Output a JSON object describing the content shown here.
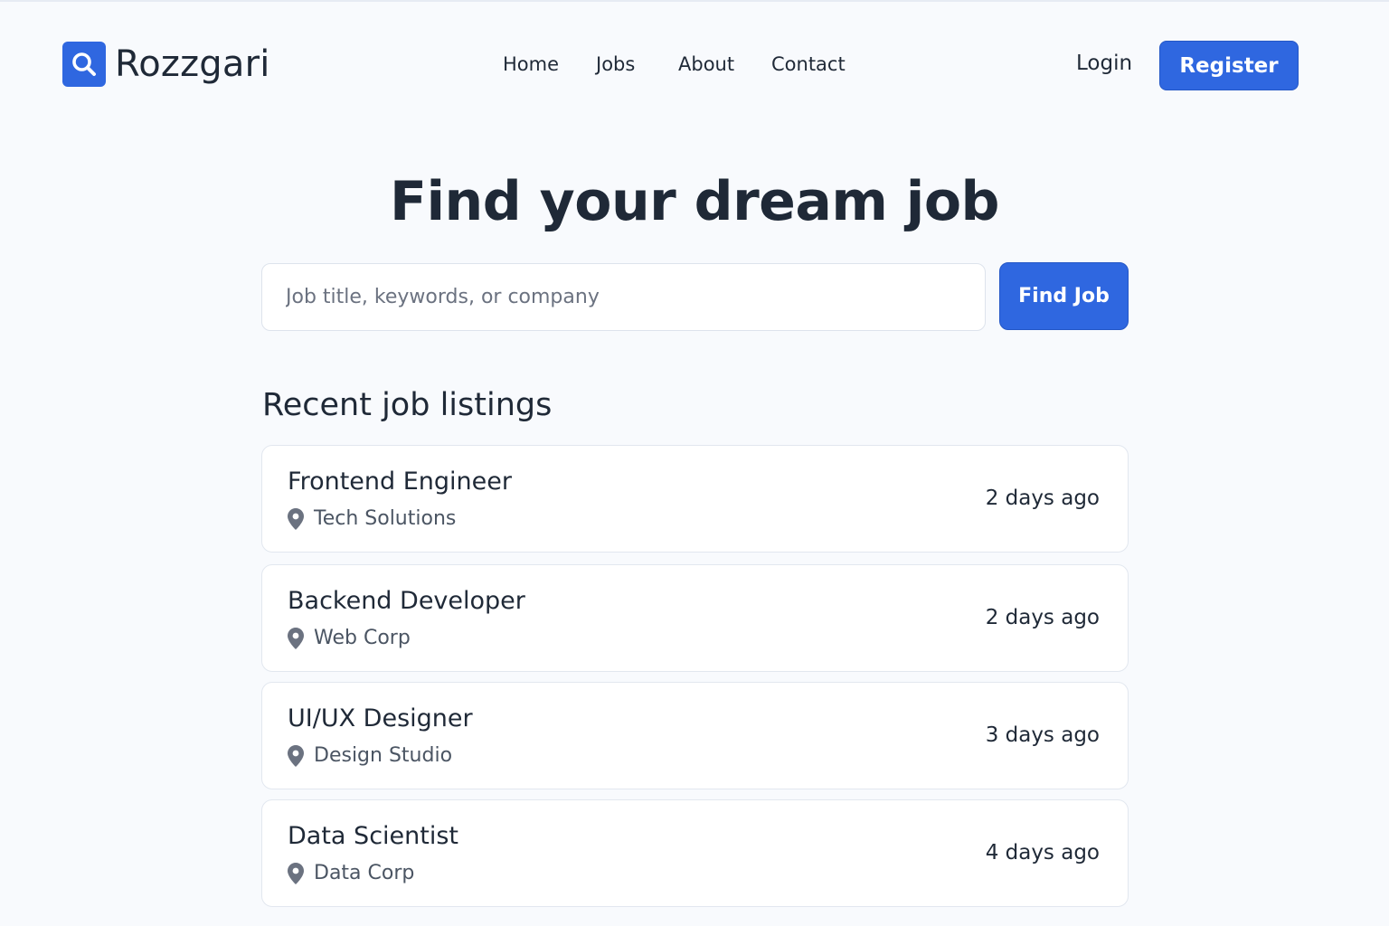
{
  "brand": {
    "name": "Rozzgari",
    "icon": "search-icon",
    "color": "#2f67e0"
  },
  "nav": [
    {
      "label": "Home"
    },
    {
      "label": "Jobs"
    },
    {
      "label": "About"
    },
    {
      "label": "Contact"
    }
  ],
  "auth": {
    "login_label": "Login",
    "register_label": "Register"
  },
  "hero": {
    "title": "Find your dream job"
  },
  "search": {
    "placeholder": "Job title, keywords, or company",
    "value": "",
    "button_label": "Find Job"
  },
  "listings": {
    "heading": "Recent job listings",
    "location_icon": "map-pin-icon",
    "items": [
      {
        "title": "Frontend Engineer",
        "company": "Tech Solutions",
        "posted": "2 days ago"
      },
      {
        "title": "Backend Developer",
        "company": "Web Corp",
        "posted": "2 days ago"
      },
      {
        "title": "UI/UX Designer",
        "company": "Design Studio",
        "posted": "3 days ago"
      },
      {
        "title": "Data Scientist",
        "company": "Data Corp",
        "posted": "4 days ago"
      }
    ]
  }
}
